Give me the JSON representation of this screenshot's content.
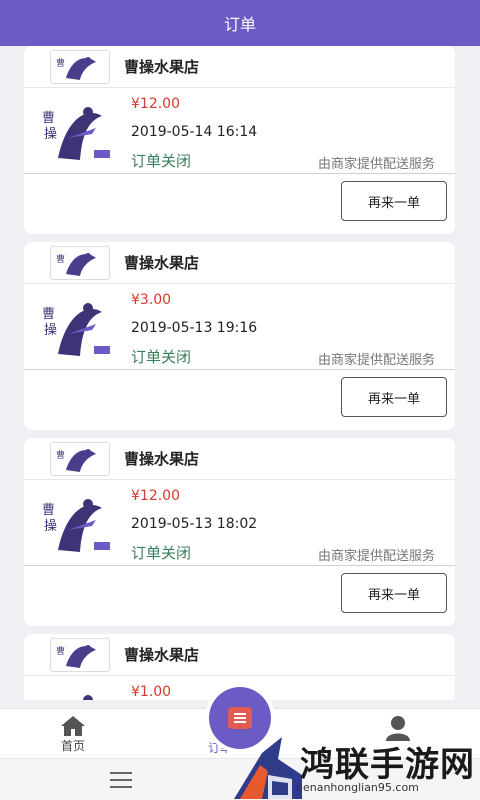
{
  "header": {
    "title": "订单"
  },
  "orders": [
    {
      "shop": "曹操水果店",
      "price": "¥12.00",
      "time": "2019-05-14 16:14",
      "status": "订单关闭",
      "delivery": "由商家提供配送服务",
      "action": "再来一单"
    },
    {
      "shop": "曹操水果店",
      "price": "¥3.00",
      "time": "2019-05-13 19:16",
      "status": "订单关闭",
      "delivery": "由商家提供配送服务",
      "action": "再来一单"
    },
    {
      "shop": "曹操水果店",
      "price": "¥12.00",
      "time": "2019-05-13 18:02",
      "status": "订单关闭",
      "delivery": "由商家提供配送服务",
      "action": "再来一单"
    },
    {
      "shop": "曹操水果店",
      "price": "¥1.00"
    }
  ],
  "tabbar": {
    "home": "首页",
    "orders": "订单",
    "me": ""
  },
  "watermark": {
    "title": "鸿联手游网",
    "url": "henanhonglian95.com"
  },
  "colors": {
    "primary": "#6b5bc4",
    "price": "#d33a2c",
    "status": "#3a7d5a"
  }
}
